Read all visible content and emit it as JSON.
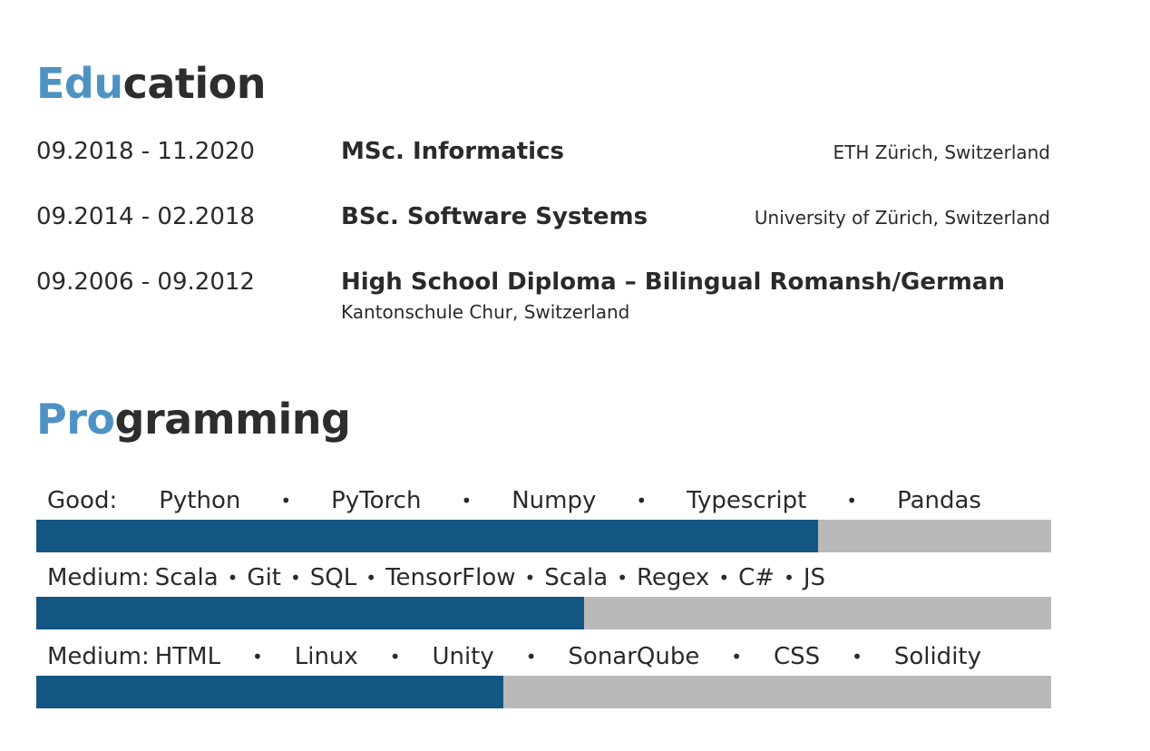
{
  "education": {
    "title_accent": "Edu",
    "title_rest": "cation",
    "entries": [
      {
        "dates": "09.2018 - 11.2020",
        "degree": "MSc. Informatics",
        "institution": "ETH Zürich, Switzerland",
        "sub": ""
      },
      {
        "dates": "09.2014 - 02.2018",
        "degree": "BSc. Software Systems",
        "institution": "University of Zürich, Switzerland",
        "sub": ""
      },
      {
        "dates": "09.2006 - 09.2012",
        "degree": "High School Diploma – Bilingual Romansh/German",
        "institution": "",
        "sub": "Kantonschule Chur, Switzerland"
      }
    ]
  },
  "programming": {
    "title_accent": "Pro",
    "title_rest": "gramming",
    "bullet": "•",
    "skills": [
      {
        "label": "Good:",
        "items": [
          "Python",
          "PyTorch",
          "Numpy",
          "Typescript",
          "Pandas"
        ],
        "level": 0.77
      },
      {
        "label": "Medium:",
        "items": [
          "Scala",
          "Git",
          "SQL",
          "TensorFlow",
          "Scala",
          "Regex",
          "C#",
          "JS"
        ],
        "level": 0.54
      },
      {
        "label": "Medium:",
        "items": [
          "HTML",
          "Linux",
          "Unity",
          "SonarQube",
          "CSS",
          "Solidity"
        ],
        "level": 0.46
      }
    ]
  },
  "colors": {
    "accent": "#4e92c3",
    "bar_fill": "#145683",
    "bar_track": "#b9b9b9"
  }
}
